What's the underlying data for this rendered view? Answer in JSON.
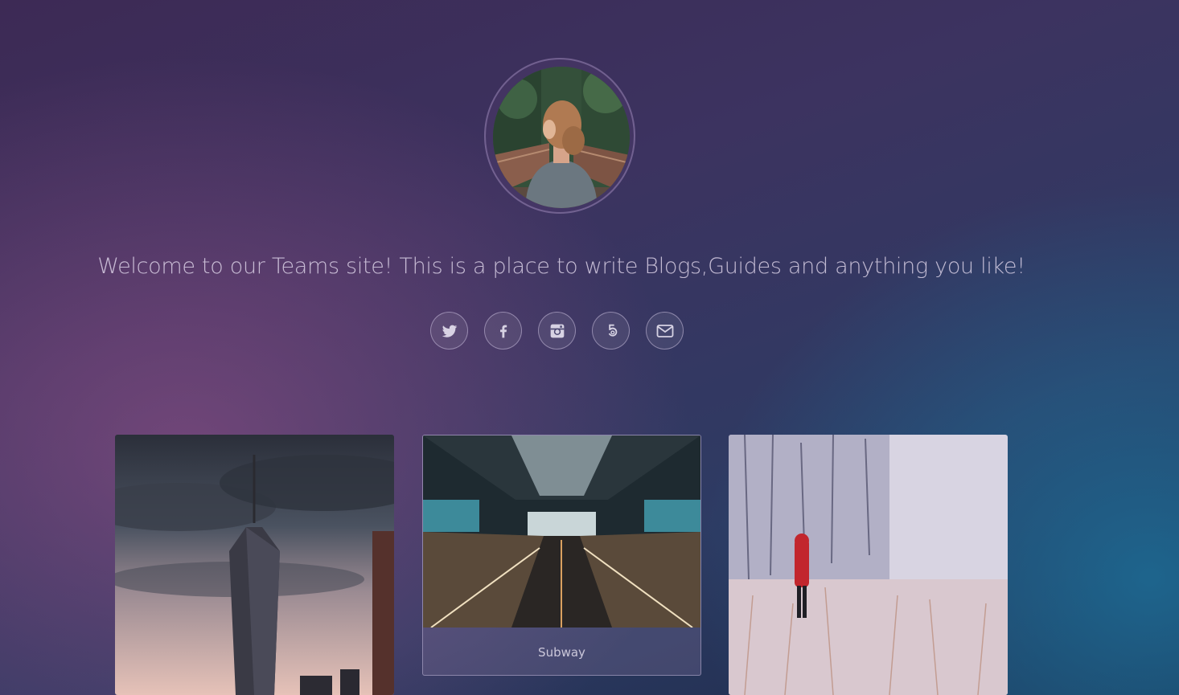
{
  "profile": {
    "avatar_alt": "Profile photo of a woman on a bridge"
  },
  "welcome": {
    "text": "Welcome to our Teams site! This is a place to write Blogs,Guides and anything you like!"
  },
  "socials": [
    {
      "name": "twitter",
      "icon": "twitter-icon"
    },
    {
      "name": "facebook",
      "icon": "facebook-icon"
    },
    {
      "name": "instagram",
      "icon": "instagram-icon"
    },
    {
      "name": "500px",
      "icon": "500px-icon"
    },
    {
      "name": "email",
      "icon": "envelope-icon"
    }
  ],
  "cards": [
    {
      "image": "city-skyline-photo",
      "caption": ""
    },
    {
      "image": "subway-escalator-photo",
      "caption": "Subway"
    },
    {
      "image": "snowy-forest-photo",
      "caption": ""
    }
  ],
  "colors": {
    "bg_top": "#3d2a55",
    "bg_pink": "#a0548c",
    "bg_blue": "#1c76a0",
    "text": "#e1d7eb"
  }
}
